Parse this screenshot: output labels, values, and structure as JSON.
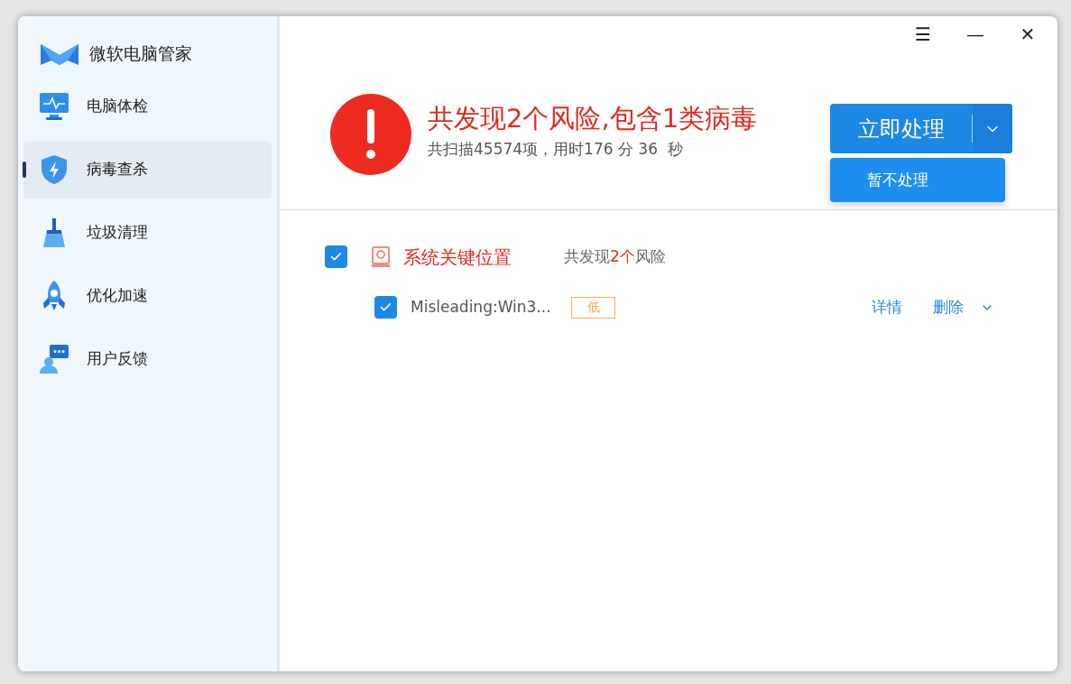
{
  "app": {
    "title": "微软电脑管家"
  },
  "sidebar": {
    "items": [
      {
        "label": "电脑体检",
        "kind": "monitor",
        "selected": false
      },
      {
        "label": "病毒查杀",
        "kind": "shield",
        "selected": true
      },
      {
        "label": "垃圾清理",
        "kind": "broom",
        "selected": false
      },
      {
        "label": "优化加速",
        "kind": "rocket",
        "selected": false
      },
      {
        "label": "用户反馈",
        "kind": "feedback",
        "selected": false
      }
    ]
  },
  "window_controls": [
    "☰",
    "—",
    "✕"
  ],
  "result": {
    "title": "共发现2个风险,包含1类病毒",
    "subtitle": "共扫描45574项，用时176 分 36  秒"
  },
  "primary_button": {
    "label": "立即处理",
    "menu_open": true
  },
  "menu": {
    "items": [
      "暂不处理"
    ]
  },
  "group": {
    "checked": true,
    "title": "系统关键位置",
    "summary_before": "共发现",
    "summary_count": "2个",
    "summary_after": "风险",
    "threats": [
      {
        "checked": true,
        "name": "Misleading:Win3...",
        "severity": "低",
        "actions": [
          "详情",
          "删除"
        ]
      }
    ]
  }
}
